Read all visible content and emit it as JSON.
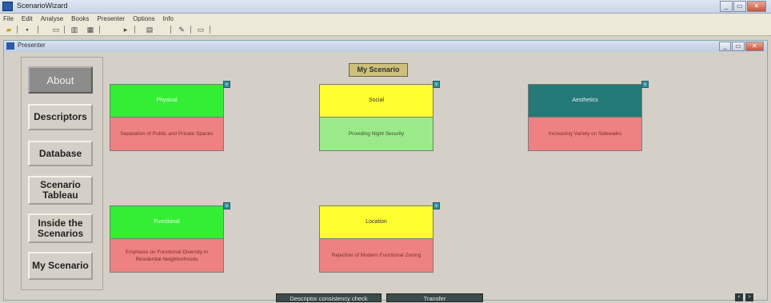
{
  "window": {
    "title": "ScenarioWizard"
  },
  "menu": [
    "File",
    "Edit",
    "Analyse",
    "Books",
    "Presenter",
    "Options",
    "Info"
  ],
  "toolbar_icons": [
    "open-folder-icon",
    "save-icon",
    "window-icon",
    "columns-icon",
    "grid-icon",
    "play-icon",
    "chart-icon",
    "pen-icon",
    "panel-icon"
  ],
  "child_window": {
    "title": "Presenter"
  },
  "nav": [
    "About",
    "Descriptors",
    "Database",
    "Scenario Tableau",
    "Inside the Scenarios",
    "My Scenario"
  ],
  "scenario_title": "My Scenario",
  "cards": [
    {
      "name": "physical",
      "header": "Physical",
      "value": "Separation of Public and Private Spaces"
    },
    {
      "name": "social",
      "header": "Social",
      "value": "Providing Night Security"
    },
    {
      "name": "aesthetics",
      "header": "Aesthetics",
      "value": "Increasing Variety on Sidewalks"
    },
    {
      "name": "functional",
      "header": "Functional",
      "value": "Emphasis on Functional Diversity in Residential Neighborhoods"
    },
    {
      "name": "location",
      "header": "Location",
      "value": "Rejection of Modern Functional Zoning"
    }
  ],
  "buttons": {
    "consistency": "Descriptor consistency check",
    "transfer": "Transfer"
  },
  "card_arrow_glyph": "v",
  "pager": [
    "<",
    ">"
  ],
  "colors": {
    "green": "#33ee33",
    "yellow": "#ffff2f",
    "teal": "#237a76",
    "red": "#ee8282",
    "light_green": "#9aea8a"
  }
}
